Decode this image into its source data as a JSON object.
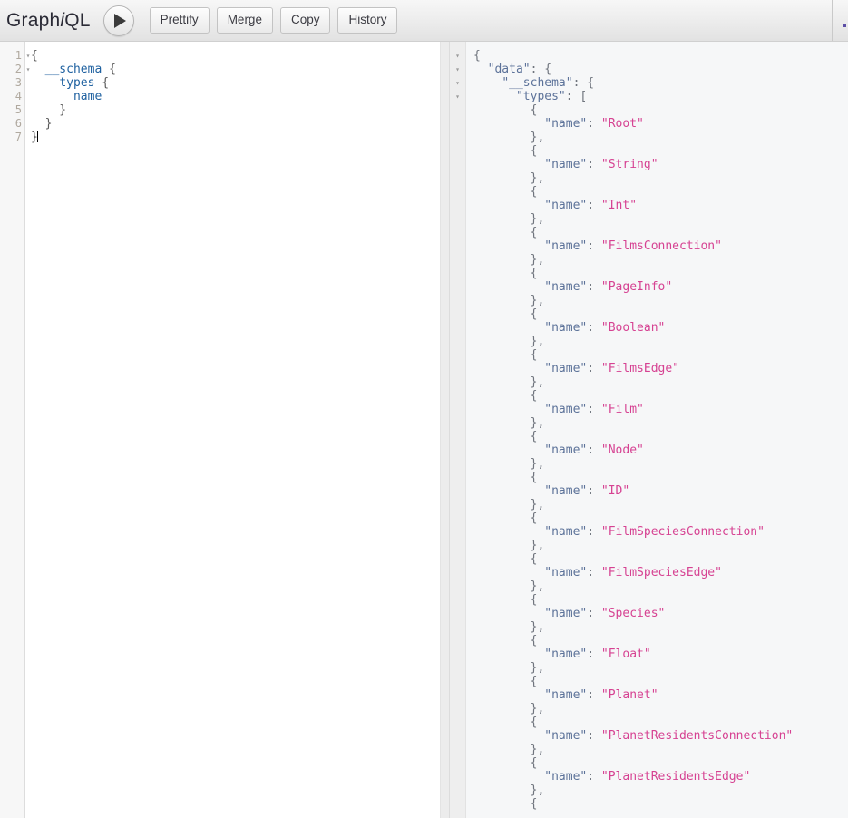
{
  "app": {
    "logo_prefix": "Graph",
    "logo_italic": "i",
    "logo_suffix": "QL"
  },
  "toolbar": {
    "execute_icon": "play-icon",
    "buttons": [
      {
        "label": "Prettify",
        "name": "prettify-button"
      },
      {
        "label": "Merge",
        "name": "merge-button"
      },
      {
        "label": "Copy",
        "name": "copy-button"
      },
      {
        "label": "History",
        "name": "history-button"
      }
    ]
  },
  "query_editor": {
    "line_numbers": [
      "1",
      "2",
      "3",
      "4",
      "5",
      "6",
      "7"
    ],
    "fold_lines": [
      1,
      2
    ],
    "fold_glyph": "▾",
    "lines": [
      [
        {
          "t": "{",
          "c": "q-punct"
        }
      ],
      [
        {
          "t": "  ",
          "c": "q-punct"
        },
        {
          "t": "__schema",
          "c": "q-field"
        },
        {
          "t": " {",
          "c": "q-punct"
        }
      ],
      [
        {
          "t": "    ",
          "c": "q-punct"
        },
        {
          "t": "types",
          "c": "q-field"
        },
        {
          "t": " {",
          "c": "q-punct"
        }
      ],
      [
        {
          "t": "      ",
          "c": "q-punct"
        },
        {
          "t": "name",
          "c": "q-field"
        }
      ],
      [
        {
          "t": "    }",
          "c": "q-punct"
        }
      ],
      [
        {
          "t": "  }",
          "c": "q-punct"
        }
      ],
      [
        {
          "t": "}",
          "c": "q-punct"
        }
      ]
    ]
  },
  "result_viewer": {
    "fold_glyph": "▾",
    "fold_count": 4,
    "types": [
      "Root",
      "String",
      "Int",
      "FilmsConnection",
      "PageInfo",
      "Boolean",
      "FilmsEdge",
      "Film",
      "Node",
      "ID",
      "FilmSpeciesConnection",
      "FilmSpeciesEdge",
      "Species",
      "Float",
      "Planet",
      "PlanetResidentsConnection",
      "PlanetResidentsEdge"
    ],
    "header_lines": [
      [
        {
          "t": "{",
          "c": "j-punct"
        }
      ],
      [
        {
          "t": "  ",
          "c": "j-punct"
        },
        {
          "t": "\"data\"",
          "c": "j-key"
        },
        {
          "t": ": {",
          "c": "j-punct"
        }
      ],
      [
        {
          "t": "    ",
          "c": "j-punct"
        },
        {
          "t": "\"__schema\"",
          "c": "j-key"
        },
        {
          "t": ": {",
          "c": "j-punct"
        }
      ],
      [
        {
          "t": "      ",
          "c": "j-punct"
        },
        {
          "t": "\"types\"",
          "c": "j-key"
        },
        {
          "t": ": [",
          "c": "j-punct"
        }
      ]
    ],
    "entry_key": "\"name\"",
    "open_brace": "        {",
    "close_brace": "        },",
    "entry_indent": "          ",
    "entry_sep": ": "
  },
  "docs": {
    "panel_name": "docs-sidebar"
  }
}
